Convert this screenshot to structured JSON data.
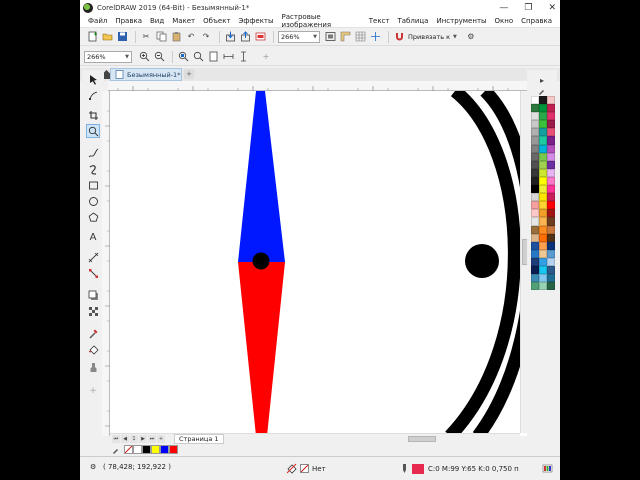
{
  "window": {
    "title": "CorelDRAW 2019 (64-Bit) - Безымянный-1*",
    "minimize_glyph": "—",
    "restore_glyph": "❐",
    "close_glyph": "✕"
  },
  "menu": [
    "Файл",
    "Правка",
    "Вид",
    "Макет",
    "Объект",
    "Эффекты",
    "Растровые изображения",
    "Текст",
    "Таблица",
    "Инструменты",
    "Окно",
    "Справка"
  ],
  "toolbar": {
    "zoom_value": "266%",
    "snap_label": "Привязать к"
  },
  "propbar": {
    "zoom_value": "266%"
  },
  "document_tab": {
    "label": "Безымянный-1*",
    "add_glyph": "+"
  },
  "page_nav": {
    "page_tab": "Страница 1"
  },
  "status": {
    "coords": "( 78,428; 192,922 )",
    "fill_label": "Нет",
    "outline_label": "C:0 M:99 Y:65 K:0  0,750 п"
  },
  "colors": {
    "compass_top": "#0018ff",
    "compass_bottom": "#ff0000",
    "outline_swatch": "#e8294f",
    "ring": "#000000"
  },
  "palette_colors": [
    "#ffffff",
    "#1a1a1a",
    "#f6c8c8",
    "#2d7a3c",
    "#00963c",
    "#c0214f",
    "#e0e0e0",
    "#2aa84a",
    "#e0316b",
    "#c8c8c8",
    "#3cc13c",
    "#9b1b4a",
    "#b0b0b0",
    "#14a0a0",
    "#e85078",
    "#989898",
    "#1ec8a0",
    "#7a1e8a",
    "#808080",
    "#00b4d8",
    "#b44fbe",
    "#686868",
    "#78c850",
    "#d28ce6",
    "#505050",
    "#a0d250",
    "#6b2fa0",
    "#383838",
    "#cde632",
    "#e6b4f0",
    "#202020",
    "#ffff00",
    "#fa78c8",
    "#000000",
    "#f0f032",
    "#ff3296",
    "#d7d7d7",
    "#ffe600",
    "#c81e5a",
    "#f5a0a0",
    "#ffd232",
    "#ff0000",
    "#ffc8c8",
    "#f0a028",
    "#a01414",
    "#e6e6e6",
    "#fab450",
    "#6e3c1e",
    "#9a6e3c",
    "#ff8c1e",
    "#c8783c",
    "#dcb48c",
    "#ff6e00",
    "#503218",
    "#1e50a0",
    "#ffa050",
    "#0a3278",
    "#2878c8",
    "#f0c896",
    "#5a9bd2",
    "#1e3c78",
    "#32a0e6",
    "#b4d2f0",
    "#0a1e50",
    "#14c8f0",
    "#2d5a8c",
    "#3c8cb4",
    "#82c8f0",
    "#1e6e96",
    "#50a078",
    "#96d2b4",
    "#286446"
  ],
  "doc_palette": [
    "#ffffff",
    "#000000",
    "#ffff00",
    "#0000ff",
    "#ff0000"
  ]
}
